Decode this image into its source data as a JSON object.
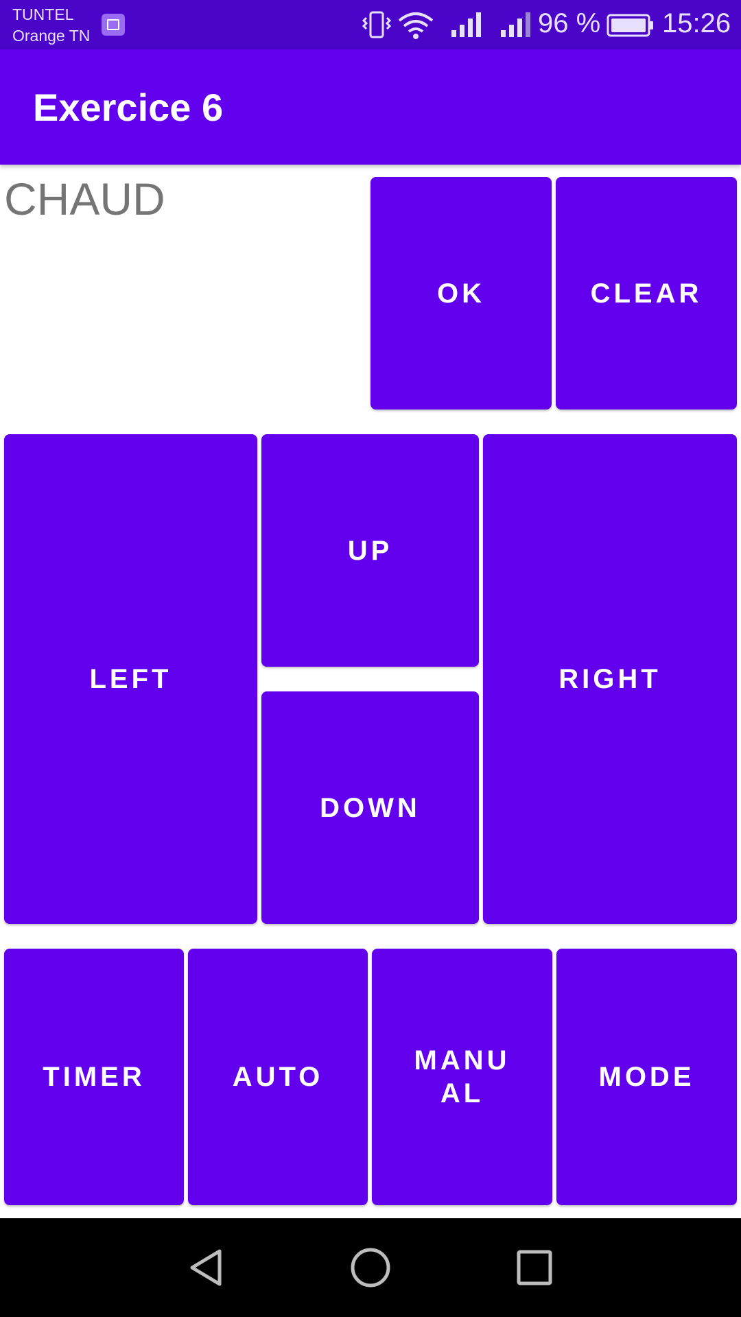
{
  "status_bar": {
    "carrier_line1": "TUNTEL",
    "carrier_line2": "Orange TN",
    "battery": "96 %",
    "time": "15:26",
    "icons": [
      "gallery-icon",
      "vibrate-icon",
      "wifi-icon",
      "signal-icon",
      "signal-icon",
      "battery-icon"
    ]
  },
  "app_bar": {
    "title": "Exercice 6"
  },
  "main": {
    "status_text": "CHAUD",
    "buttons": {
      "ok": "OK",
      "clear": "CLEAR",
      "left": "LEFT",
      "up": "UP",
      "down": "DOWN",
      "right": "RIGHT",
      "timer": "TIMER",
      "auto": "AUTO",
      "manual_line1": "MANU",
      "manual_line2": "AL",
      "mode": "MODE"
    }
  },
  "colors": {
    "primary": "#6200ee",
    "primary_dark": "#4a05c8",
    "text_secondary": "#757575"
  },
  "nav_bar": {
    "icons": [
      "back-icon",
      "home-icon",
      "recents-icon"
    ]
  }
}
